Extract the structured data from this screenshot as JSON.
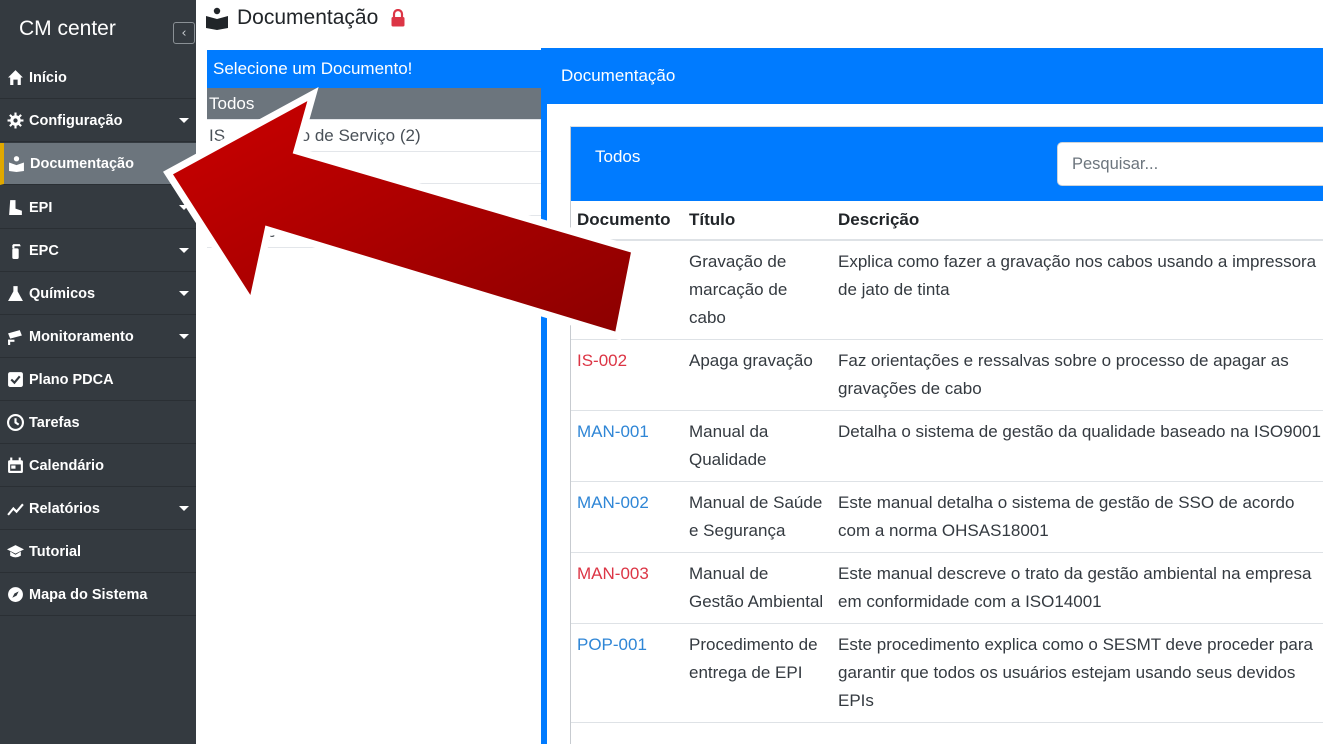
{
  "app": {
    "brand": "CM center",
    "collapse_glyph": "‹"
  },
  "sidebar": {
    "items": [
      {
        "label": "Início",
        "icon": "home-icon",
        "caret": false
      },
      {
        "label": "Configuração",
        "icon": "gear-icon",
        "caret": true
      },
      {
        "label": "Documentação",
        "icon": "book-reader-icon",
        "caret": false,
        "active": true
      },
      {
        "label": "EPI",
        "icon": "boot-icon",
        "caret": true
      },
      {
        "label": "EPC",
        "icon": "fire-extinguisher-icon",
        "caret": true
      },
      {
        "label": "Químicos",
        "icon": "flask-icon",
        "caret": true
      },
      {
        "label": "Monitoramento",
        "icon": "cctv-icon",
        "caret": true
      },
      {
        "label": "Plano PDCA",
        "icon": "check-square-icon",
        "caret": false
      },
      {
        "label": "Tarefas",
        "icon": "clock-icon",
        "caret": false
      },
      {
        "label": "Calendário",
        "icon": "calendar-icon",
        "caret": false
      },
      {
        "label": "Relatórios",
        "icon": "chart-line-icon",
        "caret": true
      },
      {
        "label": "Tutorial",
        "icon": "graduation-cap-icon",
        "caret": false
      },
      {
        "label": "Mapa do Sistema",
        "icon": "compass-icon",
        "caret": false
      }
    ]
  },
  "header": {
    "title": "Documentação",
    "icon": "book-reader-icon",
    "lock_icon": "lock-icon"
  },
  "doc_panel": {
    "header": "Selecione um Documento!",
    "rows": [
      {
        "label": "Todos",
        "selected": true
      },
      {
        "label": "IS - Instrução de Serviço (2)"
      },
      {
        "label": ""
      },
      {
        "label": ""
      },
      {
        "label": "ES - Especificação"
      }
    ]
  },
  "main": {
    "header": "Documentação",
    "filter_label": "Todos",
    "search_placeholder": "Pesquisar...",
    "columns": [
      "Documento",
      "Título",
      "Descrição"
    ],
    "rows": [
      {
        "code": "",
        "code_color": "red",
        "title": "Gravação de marcação de cabo",
        "desc": "Explica como fazer a gravação nos cabos usando a impressora de jato de tinta"
      },
      {
        "code": "IS-002",
        "code_color": "red",
        "title": "Apaga gravação",
        "desc": "Faz orientações e ressalvas sobre o processo de apagar as gravações de cabo"
      },
      {
        "code": "MAN-001",
        "code_color": "blue",
        "title": "Manual da Qualidade",
        "desc": "Detalha o sistema de gestão da qualidade baseado na ISO9001"
      },
      {
        "code": "MAN-002",
        "code_color": "blue",
        "title": "Manual de Saúde e Segurança",
        "desc": "Este manual detalha o sistema de gestão de SSO de acordo com a norma OHSAS18001"
      },
      {
        "code": "MAN-003",
        "code_color": "red",
        "title": "Manual de Gestão Ambiental",
        "desc": "Este manual descreve o trato da gestão ambiental na empresa em conformidade com a ISO14001"
      },
      {
        "code": "POP-001",
        "code_color": "blue",
        "title": "Procedimento de entrega de EPI",
        "desc": "Este procedimento explica como o SESMT deve proceder para garantir que todos os usuários estejam usando seus devidos EPIs"
      }
    ]
  },
  "colors": {
    "sidebar_bg": "#343a40",
    "primary": "#007bff",
    "active_bar": "#e0a800",
    "arrow": "#b30000",
    "link_blue": "#2f86d6",
    "link_red": "#dc3545"
  }
}
